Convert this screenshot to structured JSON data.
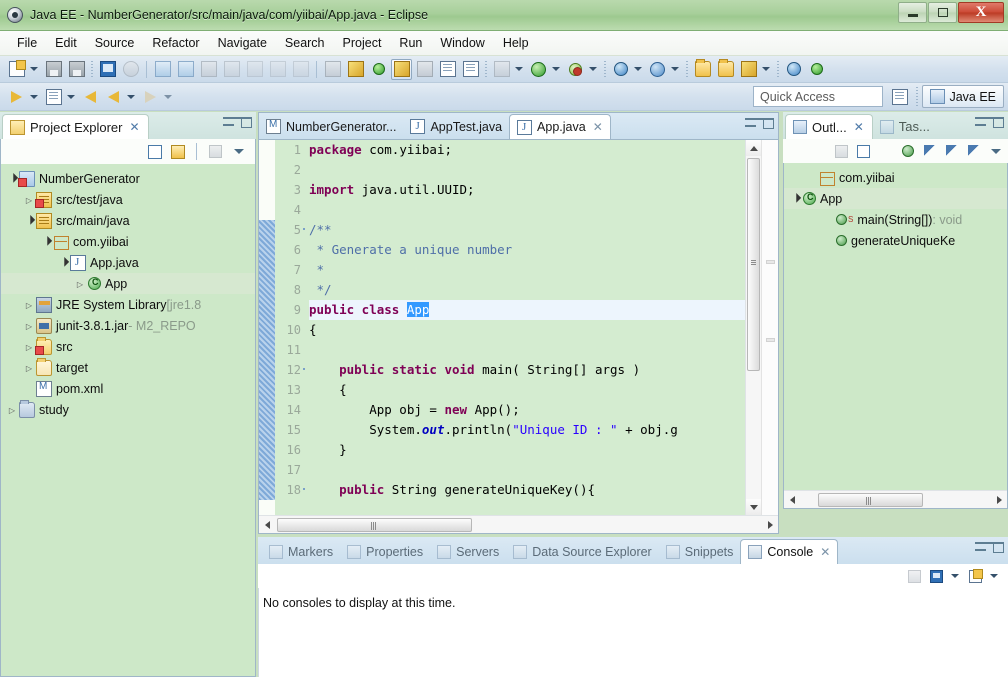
{
  "window": {
    "title": "Java EE - NumberGenerator/src/main/java/com/yiibai/App.java - Eclipse",
    "app_icon": "eclipse-icon",
    "buttons": {
      "minimize": "–",
      "maximize": "❐",
      "close": "X"
    }
  },
  "menubar": {
    "items": [
      "File",
      "Edit",
      "Source",
      "Refactor",
      "Navigate",
      "Search",
      "Project",
      "Run",
      "Window",
      "Help"
    ]
  },
  "toolbar": {
    "quick_access_placeholder": "Quick Access",
    "perspective": {
      "label": "Java EE",
      "icon": "javaee-perspective-icon"
    },
    "open_perspective_icon": "open-perspective-icon",
    "row1": [
      {
        "name": "new-wizard",
        "icon": "new-document-icon",
        "dropdown": true
      },
      {
        "name": "save",
        "icon": "save-icon",
        "dropdown": false
      },
      {
        "name": "save-all",
        "icon": "save-all-icon",
        "dropdown": false
      },
      {
        "name": "console-view",
        "icon": "console-icon",
        "dropdown": false
      },
      {
        "name": "toggle-breakpoint",
        "icon": "skip-breakpoints-icon",
        "dropdown": false
      },
      {
        "name": "step-into",
        "icon": "step-into-icon",
        "dropdown": false
      },
      {
        "name": "step-over",
        "icon": "step-over-icon",
        "dropdown": false
      },
      {
        "name": "terminate",
        "icon": "terminate-icon",
        "dropdown": false
      },
      {
        "name": "link-editor",
        "icon": "link-icon",
        "dropdown": false
      },
      {
        "name": "next-annotation",
        "icon": "next-annotation-icon",
        "dropdown": false
      },
      {
        "name": "previous-annotation",
        "icon": "previous-annotation-icon",
        "dropdown": false
      },
      {
        "name": "last-edit-location",
        "icon": "last-edit-icon",
        "dropdown": false
      },
      {
        "name": "build-all",
        "icon": "build-icon",
        "dropdown": false
      },
      {
        "name": "search",
        "icon": "search-icon",
        "dropdown": false
      },
      {
        "name": "open-type",
        "icon": "open-type-icon",
        "dropdown": false
      },
      {
        "name": "highlight",
        "icon": "highlight-icon",
        "dropdown": false,
        "active": true
      },
      {
        "name": "open-task",
        "icon": "open-task-icon",
        "dropdown": false
      },
      {
        "name": "show-whitespace",
        "icon": "whitespace-icon",
        "dropdown": false
      },
      {
        "name": "pilcrow",
        "icon": "pilcrow-icon",
        "dropdown": false
      },
      {
        "name": "debug",
        "icon": "debug-icon",
        "dropdown": true
      },
      {
        "name": "run",
        "icon": "run-icon",
        "dropdown": true
      },
      {
        "name": "run-external-tools",
        "icon": "external-tools-icon",
        "dropdown": true
      },
      {
        "name": "new-java-project",
        "icon": "new-java-project-icon",
        "dropdown": true
      },
      {
        "name": "new-servlet",
        "icon": "new-servlet-icon",
        "dropdown": true
      },
      {
        "name": "open-file",
        "icon": "open-folder-icon",
        "dropdown": false
      },
      {
        "name": "open-resource",
        "icon": "open-folder2-icon",
        "dropdown": false
      },
      {
        "name": "edit-config",
        "icon": "pencil-icon",
        "dropdown": true
      },
      {
        "name": "open-web-browser",
        "icon": "globe-icon",
        "dropdown": false
      },
      {
        "name": "deploy",
        "icon": "deploy-icon",
        "dropdown": false
      }
    ],
    "row2": [
      {
        "name": "run-last",
        "icon": "run-history-icon",
        "dropdown": true
      },
      {
        "name": "debug-last",
        "icon": "debug-history-icon",
        "dropdown": true
      },
      {
        "name": "back",
        "icon": "back-arrow-icon",
        "dropdown": false
      },
      {
        "name": "forward",
        "icon": "forward-arrow-icon",
        "dropdown": true
      },
      {
        "name": "next",
        "icon": "next-arrow-icon",
        "dropdown": true
      }
    ]
  },
  "explorer": {
    "tab": {
      "label": "Project Explorer",
      "icon": "project-explorer-icon",
      "close": "✕"
    },
    "toolbar": [
      {
        "name": "collapse-all",
        "icon": "collapse-all-icon"
      },
      {
        "name": "link-with-editor",
        "icon": "link-with-editor-icon"
      },
      {
        "name": "view-menu-extra",
        "icon": "focus-icon"
      },
      {
        "name": "view-menu",
        "icon": "view-menu-icon"
      }
    ],
    "controls": {
      "minimize": "minimize-icon",
      "maximize": "maximize-icon"
    },
    "tree": [
      {
        "label": "NumberGenerator",
        "suffix": "",
        "indent": 0,
        "twist": "open",
        "icon": "java-project-icon"
      },
      {
        "label": "src/test/java",
        "suffix": "",
        "indent": 1,
        "twist": "closed",
        "icon": "source-folder-error-icon"
      },
      {
        "label": "src/main/java",
        "suffix": "",
        "indent": 1,
        "twist": "open",
        "icon": "source-folder-icon"
      },
      {
        "label": "com.yiibai",
        "suffix": "",
        "indent": 2,
        "twist": "open",
        "icon": "package-icon"
      },
      {
        "label": "App.java",
        "suffix": "",
        "indent": 3,
        "twist": "open",
        "icon": "java-file-icon"
      },
      {
        "label": "App",
        "suffix": "",
        "indent": 4,
        "twist": "closed",
        "icon": "class-icon",
        "selected": true
      },
      {
        "label": "JRE System Library",
        "suffix": " [jre1.8",
        "indent": 1,
        "twist": "closed",
        "icon": "jre-library-icon"
      },
      {
        "label": "junit-3.8.1.jar",
        "suffix": " - M2_REPO",
        "indent": 1,
        "twist": "closed",
        "icon": "jar-icon"
      },
      {
        "label": "src",
        "suffix": "",
        "indent": 1,
        "twist": "closed",
        "icon": "folder-error-icon"
      },
      {
        "label": "target",
        "suffix": "",
        "indent": 1,
        "twist": "closed",
        "icon": "folder-icon"
      },
      {
        "label": "pom.xml",
        "suffix": "",
        "indent": 1,
        "twist": "none",
        "icon": "maven-pom-icon"
      },
      {
        "label": "study",
        "suffix": "",
        "indent": 0,
        "twist": "closed",
        "icon": "project-closed-icon"
      }
    ]
  },
  "editor": {
    "tabs": [
      {
        "label": "NumberGenerator...",
        "icon": "maven-pom-icon",
        "active": false,
        "closable": false
      },
      {
        "label": "AppTest.java",
        "icon": "java-file-error-icon",
        "active": false,
        "closable": false
      },
      {
        "label": "App.java",
        "icon": "java-file-icon",
        "active": true,
        "closable": true,
        "close": "✕"
      }
    ],
    "controls": {
      "minimize": "minimize-icon",
      "maximize": "maximize-icon"
    },
    "lines": [
      {
        "n": 1,
        "fold": false,
        "current": false,
        "tokens": [
          {
            "t": "package ",
            "c": "kw"
          },
          {
            "t": "com.yiibai;",
            "c": "plain"
          }
        ]
      },
      {
        "n": 2,
        "fold": false,
        "current": false,
        "tokens": []
      },
      {
        "n": 3,
        "fold": false,
        "current": false,
        "tokens": [
          {
            "t": "import ",
            "c": "kw"
          },
          {
            "t": "java.util.UUID;",
            "c": "plain"
          }
        ]
      },
      {
        "n": 4,
        "fold": false,
        "current": false,
        "tokens": []
      },
      {
        "n": 5,
        "fold": true,
        "current": false,
        "tokens": [
          {
            "t": "/**",
            "c": "cmt"
          }
        ]
      },
      {
        "n": 6,
        "fold": false,
        "current": false,
        "tokens": [
          {
            "t": " * Generate a unique number",
            "c": "cmt"
          }
        ]
      },
      {
        "n": 7,
        "fold": false,
        "current": false,
        "tokens": [
          {
            "t": " *",
            "c": "cmt"
          }
        ]
      },
      {
        "n": 8,
        "fold": false,
        "current": false,
        "tokens": [
          {
            "t": " */",
            "c": "cmt"
          }
        ]
      },
      {
        "n": 9,
        "fold": false,
        "current": true,
        "tokens": [
          {
            "t": "public class ",
            "c": "kw"
          },
          {
            "t": "App",
            "c": "sel-token"
          }
        ]
      },
      {
        "n": 10,
        "fold": false,
        "current": false,
        "tokens": [
          {
            "t": "{",
            "c": "plain"
          }
        ]
      },
      {
        "n": 11,
        "fold": false,
        "current": false,
        "tokens": []
      },
      {
        "n": 12,
        "fold": true,
        "current": false,
        "tokens": [
          {
            "t": "    public static void ",
            "c": "kw"
          },
          {
            "t": "main( String[] args )",
            "c": "plain"
          }
        ]
      },
      {
        "n": 13,
        "fold": false,
        "current": false,
        "tokens": [
          {
            "t": "    {",
            "c": "plain"
          }
        ]
      },
      {
        "n": 14,
        "fold": false,
        "current": false,
        "tokens": [
          {
            "t": "        App obj = ",
            "c": "plain"
          },
          {
            "t": "new ",
            "c": "kw"
          },
          {
            "t": "App();",
            "c": "plain"
          }
        ]
      },
      {
        "n": 15,
        "fold": false,
        "current": false,
        "tokens": [
          {
            "t": "        System.",
            "c": "plain"
          },
          {
            "t": "out",
            "c": "fld"
          },
          {
            "t": ".println(",
            "c": "plain"
          },
          {
            "t": "\"Unique ID : \"",
            "c": "str"
          },
          {
            "t": " + obj.g",
            "c": "plain"
          }
        ]
      },
      {
        "n": 16,
        "fold": false,
        "current": false,
        "tokens": [
          {
            "t": "    }",
            "c": "plain"
          }
        ]
      },
      {
        "n": 17,
        "fold": false,
        "current": false,
        "tokens": []
      },
      {
        "n": 18,
        "fold": true,
        "current": false,
        "tokens": [
          {
            "t": "    public ",
            "c": "kw"
          },
          {
            "t": "String generateUniqueKey(){",
            "c": "plain"
          }
        ]
      }
    ],
    "scrollbars": {
      "vertical": "vertical-scrollbar",
      "horizontal": "horizontal-scrollbar"
    }
  },
  "outline": {
    "tabs": [
      {
        "label": "Outl...",
        "icon": "outline-icon",
        "active": true,
        "close": "✕"
      },
      {
        "label": "Tas...",
        "icon": "tasks-icon",
        "active": false
      }
    ],
    "controls": {
      "minimize": "minimize-icon",
      "maximize": "maximize-icon"
    },
    "toolbar": [
      {
        "name": "focus-on-active-task",
        "icon": "focus-icon"
      },
      {
        "name": "collapse-all",
        "icon": "collapse-all-icon"
      },
      {
        "name": "sort",
        "icon": "sort-az-icon"
      },
      {
        "name": "hide-fields",
        "icon": "hide-fields-icon"
      },
      {
        "name": "hide-static",
        "icon": "hide-static-icon"
      },
      {
        "name": "hide-non-public",
        "icon": "hide-nonpublic-icon"
      },
      {
        "name": "hide-local-types",
        "icon": "hide-local-icon"
      },
      {
        "name": "view-menu",
        "icon": "view-menu-icon"
      }
    ],
    "tree": [
      {
        "label": "com.yiibai",
        "indent": 1,
        "twist": "none",
        "icon": "package-icon"
      },
      {
        "label": "App",
        "indent": 0,
        "twist": "open",
        "icon": "class-icon",
        "selected": true
      },
      {
        "label": "main(String[])",
        "suffix": " : void",
        "indent": 2,
        "twist": "none",
        "icon": "public-method-icon",
        "static": true
      },
      {
        "label": "generateUniqueKe",
        "suffix": "",
        "indent": 2,
        "twist": "none",
        "icon": "public-method-icon"
      }
    ]
  },
  "bottom": {
    "tabs": [
      {
        "label": "Markers",
        "icon": "markers-icon",
        "active": false
      },
      {
        "label": "Properties",
        "icon": "properties-icon",
        "active": false
      },
      {
        "label": "Servers",
        "icon": "servers-icon",
        "active": false
      },
      {
        "label": "Data Source Explorer",
        "icon": "data-source-icon",
        "active": false
      },
      {
        "label": "Snippets",
        "icon": "snippets-icon",
        "active": false
      },
      {
        "label": "Console",
        "icon": "console-icon",
        "active": true,
        "close": "✕"
      }
    ],
    "controls": {
      "minimize": "minimize-icon",
      "maximize": "maximize-icon"
    },
    "toolbar": [
      {
        "name": "clear-console",
        "icon": "clear-console-icon"
      },
      {
        "name": "display-selected-console",
        "icon": "display-console-icon",
        "dropdown": true
      },
      {
        "name": "open-console",
        "icon": "open-console-icon",
        "dropdown": true
      }
    ],
    "console_message": "No consoles to display at this time."
  },
  "colors": {
    "titlebar_green": "#a7cf9a",
    "editor_bg": "#d4ecd0",
    "tree_bg": "#cde8c8",
    "keyword": "#7f0055",
    "comment": "#4f6fa8",
    "string": "#2a00ff",
    "selection": "#3399ff",
    "close_button_red": "#cc4b37"
  }
}
